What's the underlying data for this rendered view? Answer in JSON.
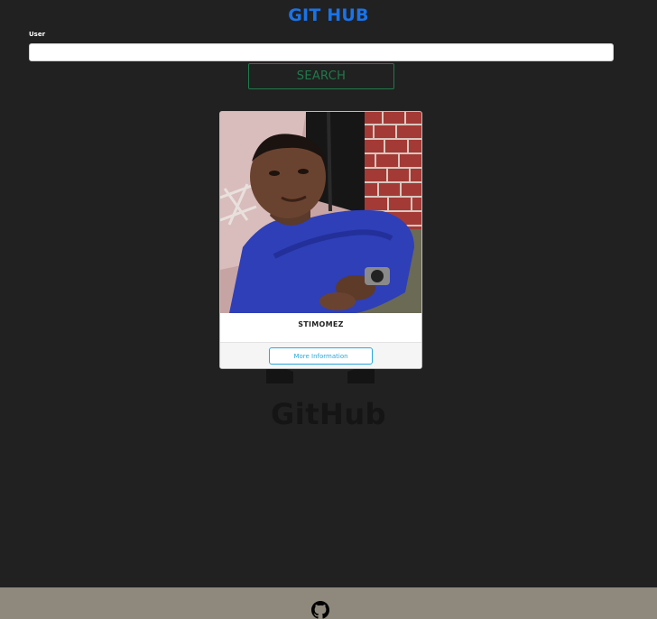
{
  "header": {
    "title": "GIT HUB"
  },
  "search": {
    "label": "User",
    "value": "",
    "placeholder": "",
    "button_label": "SEARCH"
  },
  "background": {
    "wordmark": "GitHub",
    "logo_icon": "github-octocat-icon"
  },
  "profile_card": {
    "username": "STIMOMEZ",
    "avatar_icon": "user-photo",
    "button_label": "More Information"
  },
  "footer": {
    "icon": "github-icon"
  },
  "colors": {
    "background": "#212121",
    "title": "#1a73e8",
    "search_button": "#1f7a4a",
    "info_button": "#29a8dd",
    "footer": "#8f887c"
  }
}
